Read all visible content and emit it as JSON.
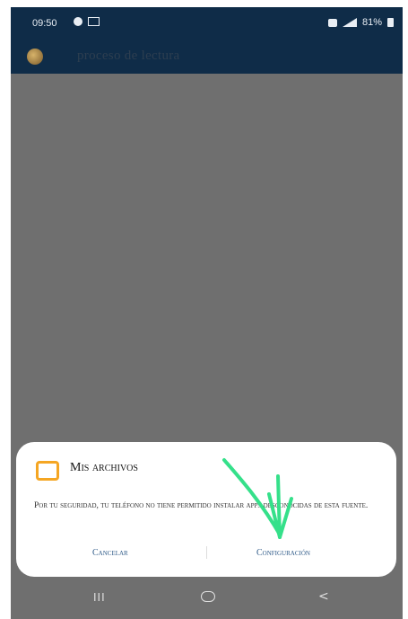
{
  "status_bar": {
    "time": "09:50",
    "battery": "81%"
  },
  "app_bar": {
    "title": "proceso de lectura"
  },
  "dialog": {
    "app_name": "Mis archivos",
    "message": "Por tu seguridad, tu teléfono no tiene permitido instalar apps desconocidas de esta fuente.",
    "cancel_label": "Cancelar",
    "settings_label": "Configuración"
  },
  "navigation": {
    "recent_label": "III",
    "back_label": "<"
  },
  "colors": {
    "status_bar_bg": "#0f2c48",
    "dim_overlay": "#6f6f6f",
    "dialog_bg": "#ffffff",
    "accent_button": "#2e5a88",
    "annotation_arrow": "#35e08a"
  }
}
